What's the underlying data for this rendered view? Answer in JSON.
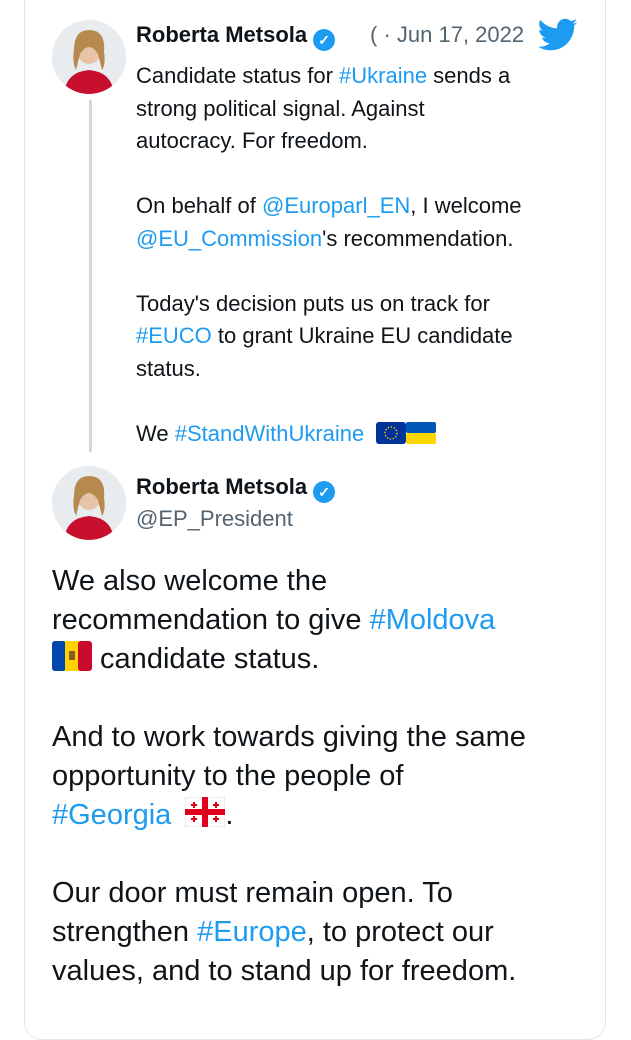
{
  "tweet1": {
    "author": "Roberta Metsola",
    "handle_fragment": "(",
    "date": "Jun 17, 2022",
    "line1_a": "Candidate status for ",
    "line1_tag": "#Ukraine",
    "line1_b": " sends a",
    "line2": "strong political signal. Against",
    "line3": "autocracy. For freedom.",
    "line4_a": "On behalf of ",
    "line4_tag": "@Europarl_EN",
    "line4_b": ", I welcome",
    "line5_tag": "@EU_Commission",
    "line5_b": "'s recommendation.",
    "line6": "Today's decision puts us on track for",
    "line7_tag": "#EUCO",
    "line7_b": " to grant Ukraine EU candidate",
    "line8": "status.",
    "line9_a": "We ",
    "line9_tag": "#StandWithUkraine"
  },
  "tweet2": {
    "author": "Roberta Metsola",
    "handle": "@EP_President",
    "l1": "We also welcome the",
    "l2_a": "recommendation to give ",
    "l2_tag": "#Moldova",
    "l3_b": " candidate status.",
    "l4": "And to work towards giving the same",
    "l5": "opportunity to the people of",
    "l6_tag": "#Georgia",
    "l6_b": ".",
    "l7": "Our door must remain open. To",
    "l8_a": "strengthen ",
    "l8_tag": "#Europe",
    "l8_b": ", to protect our",
    "l9": "values, and to stand up for freedom."
  },
  "colors": {
    "link": "#1d9bf0",
    "text": "#0f1419",
    "muted": "#536471"
  },
  "icons": [
    "twitter-bird-icon",
    "verified-badge-icon",
    "eu-flag-icon",
    "ukraine-flag-icon",
    "moldova-flag-icon",
    "georgia-flag-icon"
  ]
}
